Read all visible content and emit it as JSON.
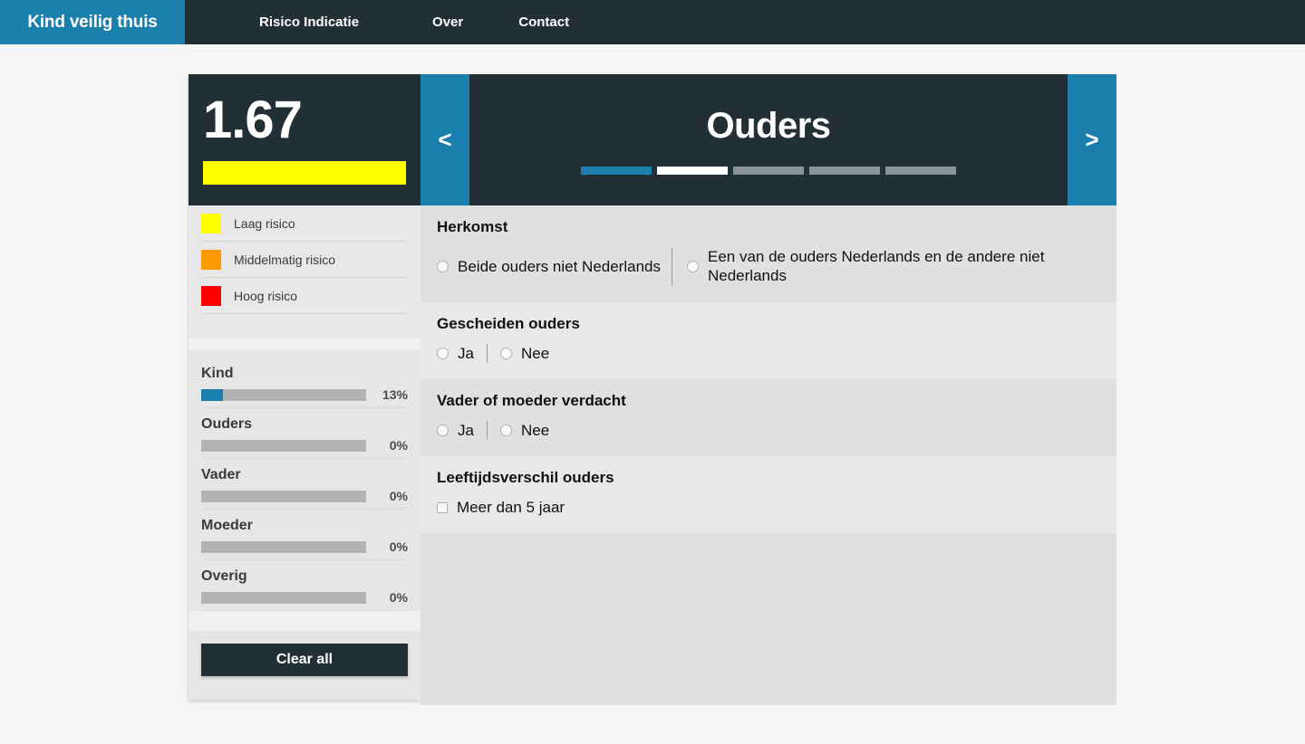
{
  "nav": {
    "brand": "Kind veilig thuis",
    "links": [
      "Risico Indicatie",
      "Over",
      "Contact"
    ]
  },
  "sidebar": {
    "score": {
      "value": "1.67",
      "bar_color": "#ffff00"
    },
    "legend": [
      {
        "label": "Laag risico",
        "color": "#ffff00"
      },
      {
        "label": "Middelmatig risico",
        "color": "#fb9a00"
      },
      {
        "label": "Hoog risico",
        "color": "#ff0000"
      }
    ],
    "progress": [
      {
        "label": "Kind",
        "percent_label": "13%",
        "percent": 13
      },
      {
        "label": "Ouders",
        "percent_label": "0%",
        "percent": 0
      },
      {
        "label": "Vader",
        "percent_label": "0%",
        "percent": 0
      },
      {
        "label": "Moeder",
        "percent_label": "0%",
        "percent": 0
      },
      {
        "label": "Overig",
        "percent_label": "0%",
        "percent": 0
      }
    ],
    "clear_label": "Clear all"
  },
  "main": {
    "prev_label": "<",
    "next_label": ">",
    "section_title": "Ouders",
    "steps": [
      {
        "state": "done"
      },
      {
        "state": "current"
      },
      {
        "state": "todo"
      },
      {
        "state": "todo"
      },
      {
        "state": "todo"
      }
    ],
    "questions": [
      {
        "title": "Herkomst",
        "type": "radio",
        "options": [
          "Beide ouders niet Nederlands",
          "Een van de ouders Nederlands en de andere niet Nederlands"
        ]
      },
      {
        "title": "Gescheiden ouders",
        "type": "radio",
        "options": [
          "Ja",
          "Nee"
        ]
      },
      {
        "title": "Vader of moeder verdacht",
        "type": "radio",
        "options": [
          "Ja",
          "Nee"
        ]
      },
      {
        "title": "Leeftijdsverschil ouders",
        "type": "checkbox",
        "options": [
          "Meer dan 5 jaar"
        ]
      }
    ]
  },
  "colors": {
    "accent": "#1a7fac",
    "dark": "#222f35",
    "page_bg": "#f5f5f5"
  }
}
